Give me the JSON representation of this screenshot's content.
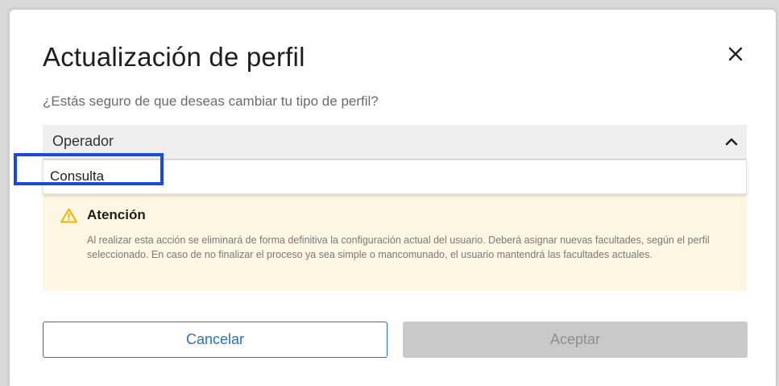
{
  "dialog": {
    "title": "Actualización de perfil",
    "subtitle": "¿Estás seguro de que deseas cambiar tu tipo de perfil?",
    "close_icon": "close-icon"
  },
  "profile_select": {
    "selected": "Operador",
    "options": [
      "Consulta"
    ],
    "expanded": true
  },
  "alert": {
    "icon": "warning-icon",
    "title": "Atención",
    "message": "Al realizar esta acción se eliminará de forma definitiva la configuración actual del usuario. Deberá asignar nuevas facultades, según el perfil seleccionado. En caso de no finalizar el proceso ya sea simple o mancomunado, el usuario mantendrá las facultades actuales.",
    "background": "#fdf6e3",
    "icon_color": "#f0b400"
  },
  "buttons": {
    "cancel": "Cancelar",
    "accept": "Aceptar"
  },
  "colors": {
    "primary": "#2d6ec8",
    "highlight_box": "#1a4bd8",
    "disabled": "#c9c9c9"
  }
}
